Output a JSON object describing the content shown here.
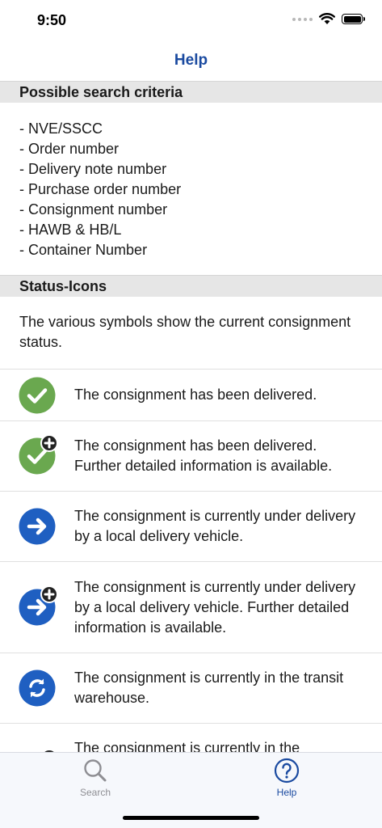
{
  "status_bar": {
    "time": "9:50"
  },
  "nav": {
    "title": "Help"
  },
  "criteria": {
    "header": "Possible search criteria",
    "items": [
      "- NVE/SSCC",
      "- Order number",
      "- Delivery note number",
      "- Purchase order number",
      "- Consignment number",
      "- HAWB & HB/L",
      "- Container Number"
    ]
  },
  "status_icons": {
    "header": "Status-Icons",
    "intro": "The various symbols show the current consignment status.",
    "rows": [
      {
        "icon": "delivered-check-icon",
        "text": "The consignment has been delivered."
      },
      {
        "icon": "delivered-check-plus-icon",
        "text": "The consignment has been delivered. Further detailed information is available."
      },
      {
        "icon": "arrow-right-icon",
        "text": "The consignment is currently under delivery by a local delivery vehicle."
      },
      {
        "icon": "arrow-right-plus-icon",
        "text": "The consignment is currently under delivery by a local delivery vehicle. Further detailed information is available."
      },
      {
        "icon": "transit-refresh-icon",
        "text": "The consignment is currently in the transit warehouse."
      },
      {
        "icon": "transit-refresh-plus-icon",
        "text": "The consignment is currently in the"
      }
    ]
  },
  "tabs": [
    {
      "label": "Search",
      "icon": "search-icon"
    },
    {
      "label": "Help",
      "icon": "question-circle-icon"
    }
  ],
  "colors": {
    "accent": "#1a4aa0",
    "delivered_green": "#6aa84f",
    "delivery_blue": "#1f5fc1",
    "section_bg": "#e6e6e6"
  }
}
